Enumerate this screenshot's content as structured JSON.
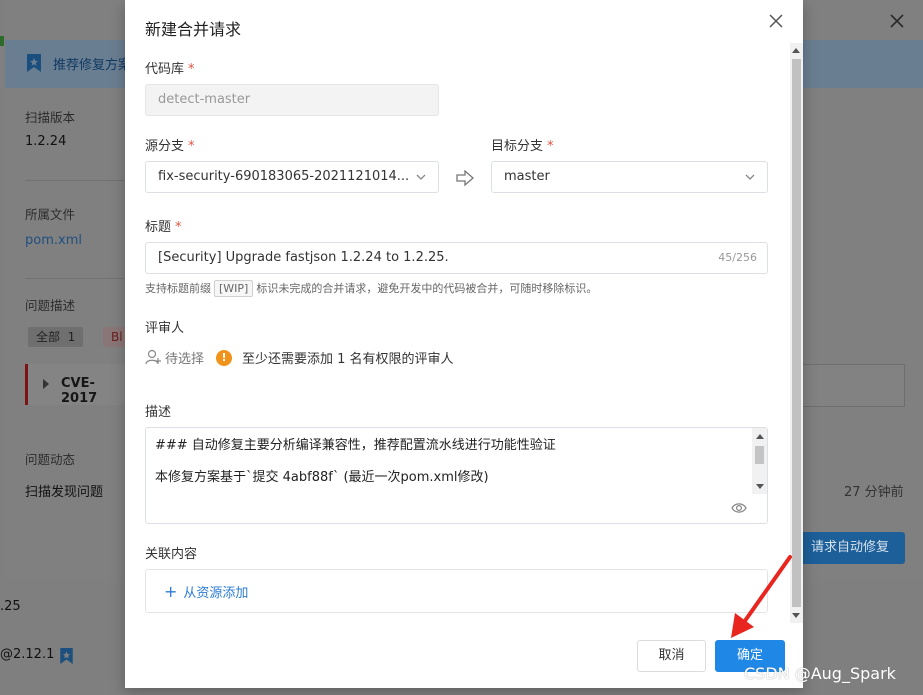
{
  "background": {
    "banner_text": "推荐修复方案",
    "scan_version_label": "扫描版本",
    "scan_version_value": "1.2.24",
    "file_label": "所属文件",
    "file_value": "pom.xml",
    "issue_desc_label": "问题描述",
    "tag_all": "全部",
    "tag_all_count": "1",
    "tag_blocker": "Bl",
    "row_title": "CVE-2017",
    "activity_label": "问题动态",
    "activity_value": "扫描发现问题",
    "activity_time": "27 分钟前",
    "auto_fix_button": "请求自动修复",
    "left_edge_1": ".25",
    "left_edge_2": "@2.12.1"
  },
  "modal": {
    "title": "新建合并请求",
    "repo_label": "代码库",
    "repo_value": "detect-master",
    "source_branch_label": "源分支",
    "source_branch_value": "fix-security-690183065-2021121014...",
    "target_branch_label": "目标分支",
    "target_branch_value": "master",
    "title_label": "标题",
    "title_value": "[Security] Upgrade fastjson 1.2.24 to 1.2.25.",
    "title_counter": "45/256",
    "hint_before": "支持标题前缀",
    "hint_wip": "[WIP]",
    "hint_after": "标识未完成的合并请求，避免开发中的代码被合并，可随时移除标识。",
    "reviewer_label": "评审人",
    "reviewer_pick": "待选择",
    "reviewer_warning": "至少还需要添加 1 名有权限的评审人",
    "desc_label": "描述",
    "desc_line1": "### 自动修复主要分析编译兼容性，推荐配置流水线进行功能性验证",
    "desc_line2": "本修复方案基于`提交 4abf88f` (最近一次pom.xml修改)",
    "related_label": "关联内容",
    "related_add": "从资源添加",
    "cancel_button": "取消",
    "ok_button": "确定",
    "required_mark": "*"
  },
  "watermark": "CSDN @Aug_Spark",
  "colors": {
    "primary": "#1f87e6",
    "required": "#e0533f",
    "warning": "#f0931a",
    "annotation_arrow": "#e8261f"
  }
}
